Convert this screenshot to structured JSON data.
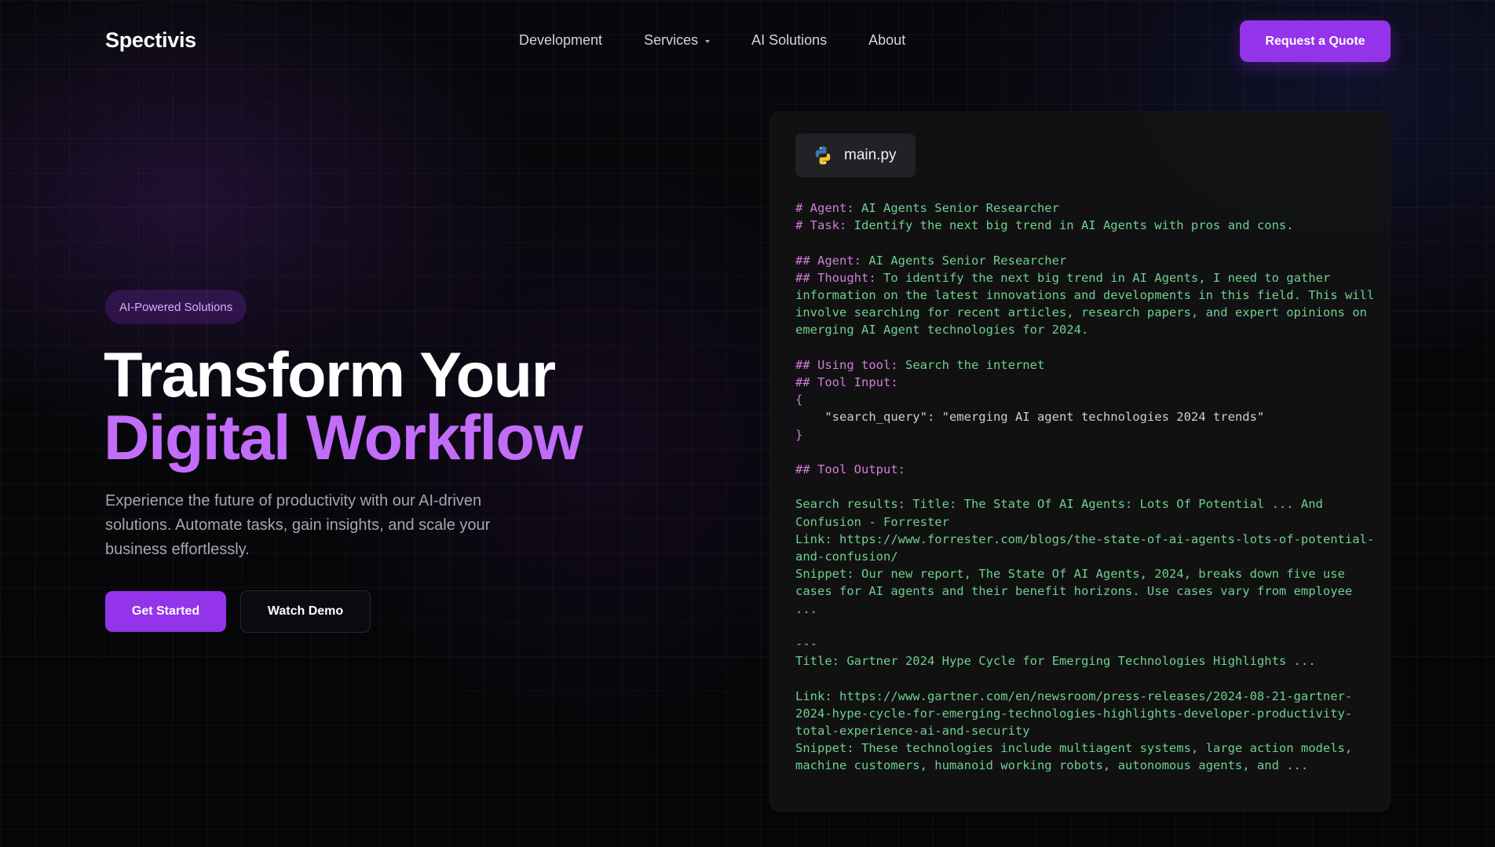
{
  "brand": {
    "name": "Spectivis",
    "accent_color": "#9333ea",
    "highlight_color": "#c26cf9"
  },
  "nav": {
    "links": [
      {
        "label": "Development"
      },
      {
        "label": "Services",
        "has_dropdown": true
      },
      {
        "label": "AI Solutions"
      },
      {
        "label": "About"
      }
    ],
    "cta_label": "Request a Quote"
  },
  "hero": {
    "badge": "AI-Powered Solutions",
    "title_line1": "Transform Your",
    "title_line2": "Digital Workflow",
    "subtitle": "Experience the future of productivity with our AI-driven solutions. Automate tasks, gain insights, and scale your business effortlessly.",
    "primary_cta": "Get Started",
    "secondary_cta": "Watch Demo"
  },
  "code_panel": {
    "file_icon": "python-icon",
    "file_name": "main.py",
    "lines": [
      {
        "kind": "kv",
        "key": "# Agent:",
        "value": " AI Agents Senior Researcher"
      },
      {
        "kind": "kv",
        "key": "# Task:",
        "value": " Identify the next big trend in AI Agents with pros and cons."
      },
      {
        "kind": "blank"
      },
      {
        "kind": "kv",
        "key": "## Agent:",
        "value": " AI Agents Senior Researcher"
      },
      {
        "kind": "kv",
        "key": "## Thought:",
        "value": " To identify the next big trend in AI Agents, I need to gather information on the latest innovations and developments in this field. This will involve searching for recent articles, research papers, and expert opinions on emerging AI Agent technologies for 2024."
      },
      {
        "kind": "blank"
      },
      {
        "kind": "kv",
        "key": "## Using tool:",
        "value": " Search the internet"
      },
      {
        "kind": "kv",
        "key": "## Tool Input:",
        "value": ""
      },
      {
        "kind": "punct",
        "text": "{"
      },
      {
        "kind": "text",
        "text": "    \"search_query\": \"emerging AI agent technologies 2024 trends\""
      },
      {
        "kind": "punct",
        "text": "}"
      },
      {
        "kind": "blank"
      },
      {
        "kind": "kv",
        "key": "## Tool Output:",
        "value": ""
      },
      {
        "kind": "blank"
      },
      {
        "kind": "plain",
        "text": "Search results: Title: The State Of AI Agents: Lots Of Potential ... And Confusion - Forrester"
      },
      {
        "kind": "plain",
        "text": "Link: https://www.forrester.com/blogs/the-state-of-ai-agents-lots-of-potential-and-confusion/"
      },
      {
        "kind": "plain",
        "text": "Snippet: Our new report, The State Of AI Agents, 2024, breaks down five use cases for AI agents and their benefit horizons. Use cases vary from employee ..."
      },
      {
        "kind": "blank"
      },
      {
        "kind": "plain",
        "text": "---"
      },
      {
        "kind": "plain",
        "text": "Title: Gartner 2024 Hype Cycle for Emerging Technologies Highlights ..."
      },
      {
        "kind": "blank"
      },
      {
        "kind": "plain",
        "text": "Link: https://www.gartner.com/en/newsroom/press-releases/2024-08-21-gartner-2024-hype-cycle-for-emerging-technologies-highlights-developer-productivity-total-experience-ai-and-security"
      },
      {
        "kind": "plain",
        "text": "Snippet: These technologies include multiagent systems, large action models, machine customers, humanoid working robots, autonomous agents, and ..."
      }
    ]
  }
}
